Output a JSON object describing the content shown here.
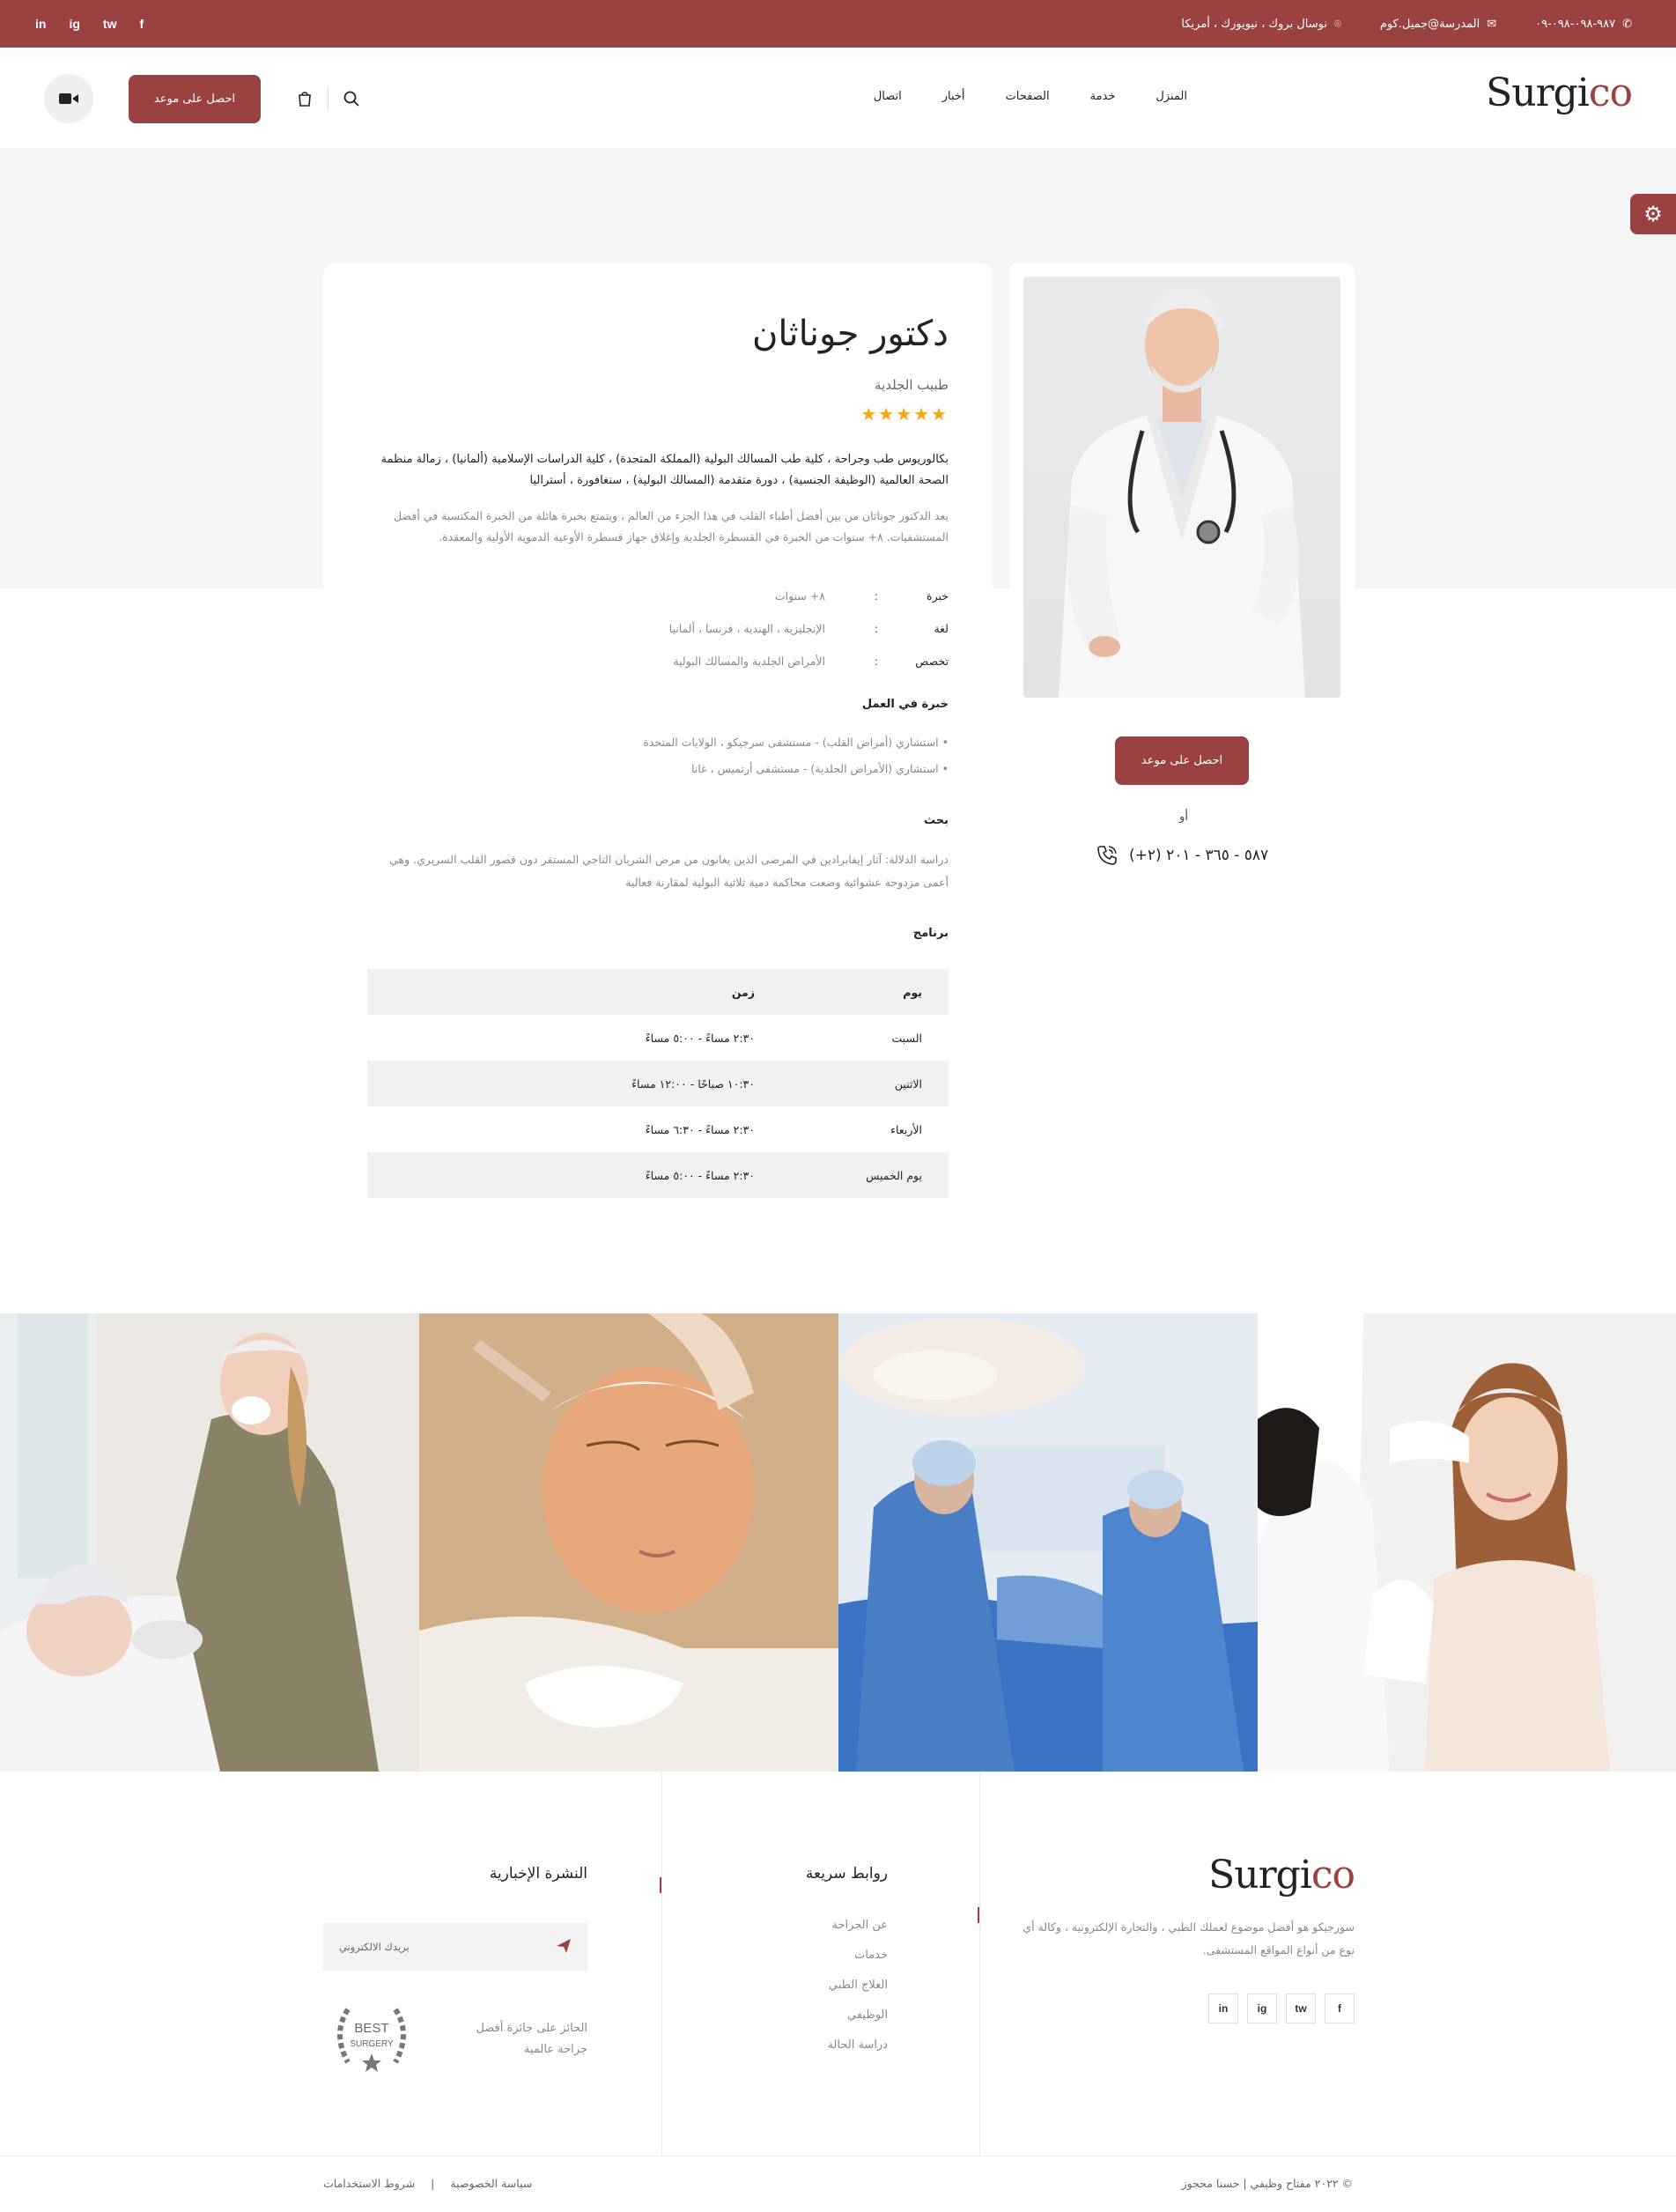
{
  "topbar": {
    "phone": "٩٨٧-٠٩٨-٠٩٨-٠٩",
    "email": "المدرسة@جميل.كوم",
    "location": "نوسال بروك ، نيويورك ، أمريكا",
    "social": [
      "in",
      "ig",
      "tw",
      "f"
    ]
  },
  "header": {
    "logo_main": "Surgi",
    "logo_accent": "co",
    "nav": [
      "المنزل",
      "خدمة",
      "الصفحات",
      "أخبار",
      "اتصال"
    ],
    "appointment_label": "احصل على موعد"
  },
  "doctor": {
    "name": "دكتور جوناثان",
    "specialty": "طبيب الجلدية",
    "stars": "★★★★★",
    "rating": 5,
    "bio_bold": "بكالوريوس طب وجراحة ، كلية طب المسالك البولية (المملكة المتحدة) ، كلية الدراسات الإسلامية (ألمانيا) ، زمالة منظمة الصحة العالمية (الوظيفة الجنسية) ، دورة متقدمة (المسالك البولية) ، سنغافورة ، أستراليا",
    "bio_light": "يعد الدكتور جوناثان من بين أفضل أطباء القلب في هذا الجزء من العالم ، ويتمتع بخبرة هائلة من الخبرة المكتسبة في أفضل المستشفيات. ٨+ سنوات من الخبرة في القسطرة الجلدية وإغلاق جهاز قسطرة الأوعية الدموية الأولية والمعقدة.",
    "info": [
      {
        "key": "خبرة",
        "colon": ":",
        "value": "٨+ سنوات"
      },
      {
        "key": "لغة",
        "colon": ":",
        "value": "الإنجليزية ، الهندية ، فرنسا ، ألمانيا"
      },
      {
        "key": "تخصص",
        "colon": ":",
        "value": "الأمراض الجلدية والمسالك البولية"
      }
    ],
    "experience_title": "خبرة في العمل",
    "experience": [
      "• استشاري (أمراض القلب) - مستشفى سرجيكو ، الولايات المتحدة",
      "• استشاري (الأمراض الجلدية) - مستشفى أرتميس ، غانا"
    ],
    "research_title": "بحث",
    "research": "دراسة الدلالة: آثار إيفابرادين في المرضى الذين يعانون من مرض الشريان التاجي المستقر دون قصور القلب السريري. وهي أعمى مزدوجة عشوائية وضعت محاكمة دمية ثلاثية البولية لمقارنة فعالية",
    "schedule_title": "برنامج",
    "schedule_head": {
      "day": "يوم",
      "time": "زمن"
    },
    "schedule": [
      {
        "day": "السبت",
        "time": "٢:٣٠ مساءً - ٥:٠٠ مساءً"
      },
      {
        "day": "الاثنين",
        "time": "١٠:٣٠ صباحًا - ١٢:٠٠ مساءً"
      },
      {
        "day": "الأربعاء",
        "time": "٢:٣٠ مساءً - ٦:٣٠ مساءً"
      },
      {
        "day": "يوم الخميس",
        "time": "٢:٣٠ مساءً - ٥:٠٠ مساءً"
      }
    ]
  },
  "side": {
    "appointment_label": "احصل على موعد",
    "or": "أو",
    "phone": "(+٢) ٥٨٧ - ٣٦٥ - ٢٠١"
  },
  "footer": {
    "logo_main": "Surgi",
    "logo_accent": "co",
    "about": "سورجيكو هو أفضل موضوع لعملك الطبي ، والتجارة الإلكترونية ، وكالة أي نوع من أنواع المواقع المستشفى.",
    "social": [
      "in",
      "ig",
      "tw",
      "f"
    ],
    "quick_links_title": "روابط سريعة",
    "quick_links": [
      "عن الجراحة",
      "خدمات",
      "العلاج الطبي",
      "الوظيفي",
      "دراسة الحالة"
    ],
    "newsletter_title": "النشرة الإخبارية",
    "newsletter_placeholder": "بريدك الالكتروني",
    "award_text": "الحائز على جائزة أفضل جراحة عالمية",
    "award_badge_top": "BEST",
    "award_badge_bottom": "SURGERY",
    "copyright": "© ٢٠٢٢ مفتاح وظيفي | حسنا محجوز",
    "privacy": "سياسة الخصوصية",
    "divider": "|",
    "terms": "شروط الاستخدامات"
  },
  "colors": {
    "accent": "#9a4141",
    "star": "#f3a712"
  }
}
